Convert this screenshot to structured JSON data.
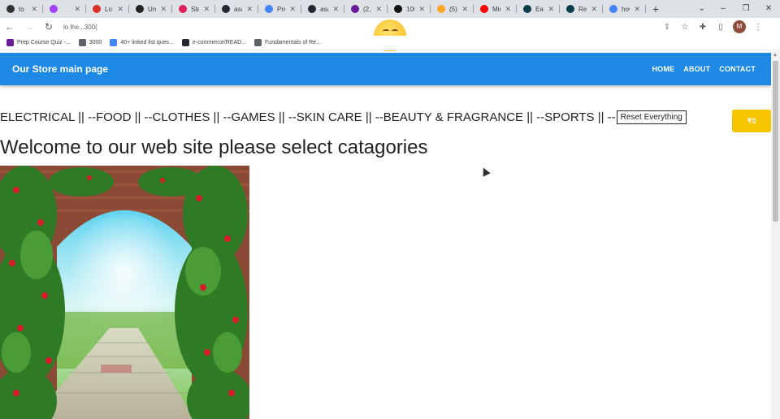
{
  "browser": {
    "tabs": [
      {
        "label": "to",
        "color": "#333333"
      },
      {
        "label": "",
        "color": "#a142f4"
      },
      {
        "label": "Lo",
        "color": "#d93025"
      },
      {
        "label": "Un",
        "color": "#222222"
      },
      {
        "label": "Sla",
        "color": "#e01e5a"
      },
      {
        "label": "asa",
        "color": "#24292f"
      },
      {
        "label": "Pre",
        "color": "#4285f4"
      },
      {
        "label": "asa",
        "color": "#24292f"
      },
      {
        "label": "(2,7",
        "color": "#6a1b9a"
      },
      {
        "label": "100",
        "color": "#111111"
      },
      {
        "label": "(5)",
        "color": "#f9a825"
      },
      {
        "label": "Min",
        "color": "#ff0000"
      },
      {
        "label": "Eas",
        "color": "#0b3d4a"
      },
      {
        "label": "Rea",
        "color": "#0b3d4a"
      },
      {
        "label": "hov",
        "color": "#4285f4"
      }
    ],
    "new_tab": "+",
    "address": "lo lhe...300(",
    "profile_initial": "M",
    "bookmarks": [
      {
        "label": "Prep Course Quiz -...",
        "color": "#6a1b9a"
      },
      {
        "label": "3000",
        "color": "#5f6368"
      },
      {
        "label": "40+ linked list ques...",
        "color": "#4285f4"
      },
      {
        "label": "e-commerce/READ...",
        "color": "#24292f"
      },
      {
        "label": "Fundamentals of Re...",
        "color": "#5f6368"
      }
    ]
  },
  "app": {
    "brand": "Our Store main page",
    "nav": [
      "HOME",
      "ABOUT",
      "CONTACT"
    ],
    "categories_text": "ELECTRICAL || --FOOD || --CLOTHES || --GAMES || --SKIN CARE || --BEAUTY & FRAGRANCE || --SPORTS || --",
    "reset_label": "Reset Everything",
    "cart_label": "₹0",
    "welcome": "Welcome to our web site please select catagories",
    "colors": {
      "appbar": "#1e88e5",
      "cart": "#f7c500"
    }
  }
}
